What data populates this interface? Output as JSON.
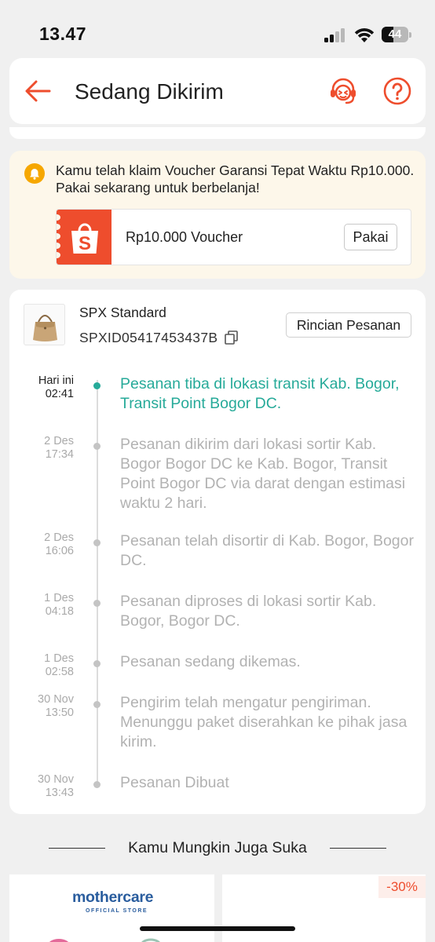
{
  "status_bar": {
    "time": "13.47",
    "battery": "44",
    "battery_level": 0.44
  },
  "header": {
    "title": "Sedang Dikirim"
  },
  "voucher": {
    "message": "Kamu telah klaim Voucher Garansi Tepat Waktu Rp10.000. Pakai sekarang untuk berbelanja!",
    "voucher_label": "Rp10.000 Voucher",
    "use_label": "Pakai"
  },
  "shipment": {
    "courier": "SPX Standard",
    "tracking_number": "SPXID05417453437B",
    "detail_button": "Rincian Pesanan",
    "events": [
      {
        "date": "Hari ini",
        "time": "02:41",
        "text": "Pesanan tiba di lokasi transit Kab. Bogor, Transit Point Bogor DC."
      },
      {
        "date": "2 Des",
        "time": "17:34",
        "text": "Pesanan dikirim dari lokasi sortir Kab. Bogor  Bogor DC ke Kab. Bogor, Transit Point Bogor DC via darat dengan estimasi waktu 2 hari."
      },
      {
        "date": "2 Des",
        "time": "16:06",
        "text": "Pesanan telah disortir di Kab. Bogor, Bogor DC."
      },
      {
        "date": "1 Des",
        "time": "04:18",
        "text": "Pesanan diproses di lokasi sortir Kab. Bogor, Bogor DC."
      },
      {
        "date": "1 Des",
        "time": "02:58",
        "text": "Pesanan sedang dikemas."
      },
      {
        "date": "30 Nov",
        "time": "13:50",
        "text": "Pengirim telah mengatur pengiriman. Menunggu paket diserahkan ke pihak jasa kirim."
      },
      {
        "date": "30 Nov",
        "time": "13:43",
        "text": "Pesanan Dibuat"
      }
    ]
  },
  "recommendations": {
    "title": "Kamu Mungkin Juga Suka",
    "brand": "mothercare",
    "brand_sub": "OFFICIAL STORE",
    "discount": "-30%"
  },
  "colors": {
    "brand": "#ee4d2d",
    "active": "#26aa99",
    "inactive": "#b2b2b2"
  }
}
